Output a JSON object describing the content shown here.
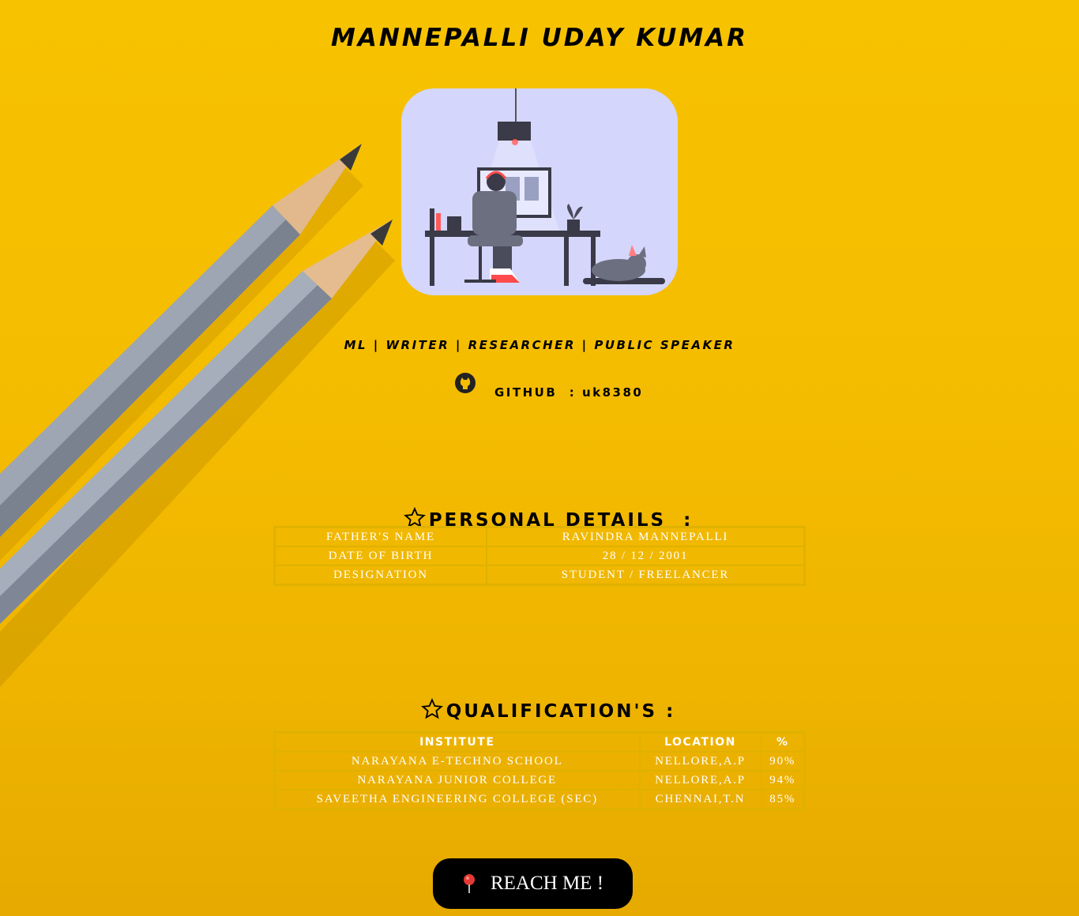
{
  "header": {
    "name": "MANNEPALLI UDAY KUMAR"
  },
  "profile": {
    "avatar_icon": "developer-at-desk-illustration"
  },
  "roles": "ML | WRITER | RESEARCHER | PUBLIC SPEAKER",
  "github": {
    "icon": "github-icon",
    "label": "GITHUB  : uk8380"
  },
  "personal": {
    "heading": "PERSONAL DETAILS  :",
    "rows": [
      [
        "FATHER'S NAME",
        "RAVINDRA MANNEPALLI"
      ],
      [
        "DATE OF BIRTH",
        "28 / 12 / 2001"
      ],
      [
        "DESIGNATION",
        "STUDENT / FREELANCER"
      ]
    ]
  },
  "qualifications": {
    "heading": "QUALIFICATION'S :",
    "headers": [
      "INSTITUTE",
      "LOCATION",
      "%"
    ],
    "rows": [
      [
        "NARAYANA E-TECHNO SCHOOL",
        "NELLORE,A.P",
        "90%"
      ],
      [
        "NARAYANA JUNIOR COLLEGE",
        "NELLORE,A.P",
        "94%"
      ],
      [
        "SAVEETHA ENGINEERING COLLEGE (SEC)",
        "CHENNAI,T.N",
        "85%"
      ]
    ]
  },
  "reach_button": {
    "label": "REACH ME !",
    "icon": "map-pin-icon"
  },
  "colors": {
    "background": "#f5bd00",
    "table_border": "#e0b100",
    "button": "#000000",
    "avatar_bg": "#d4d6fb"
  }
}
